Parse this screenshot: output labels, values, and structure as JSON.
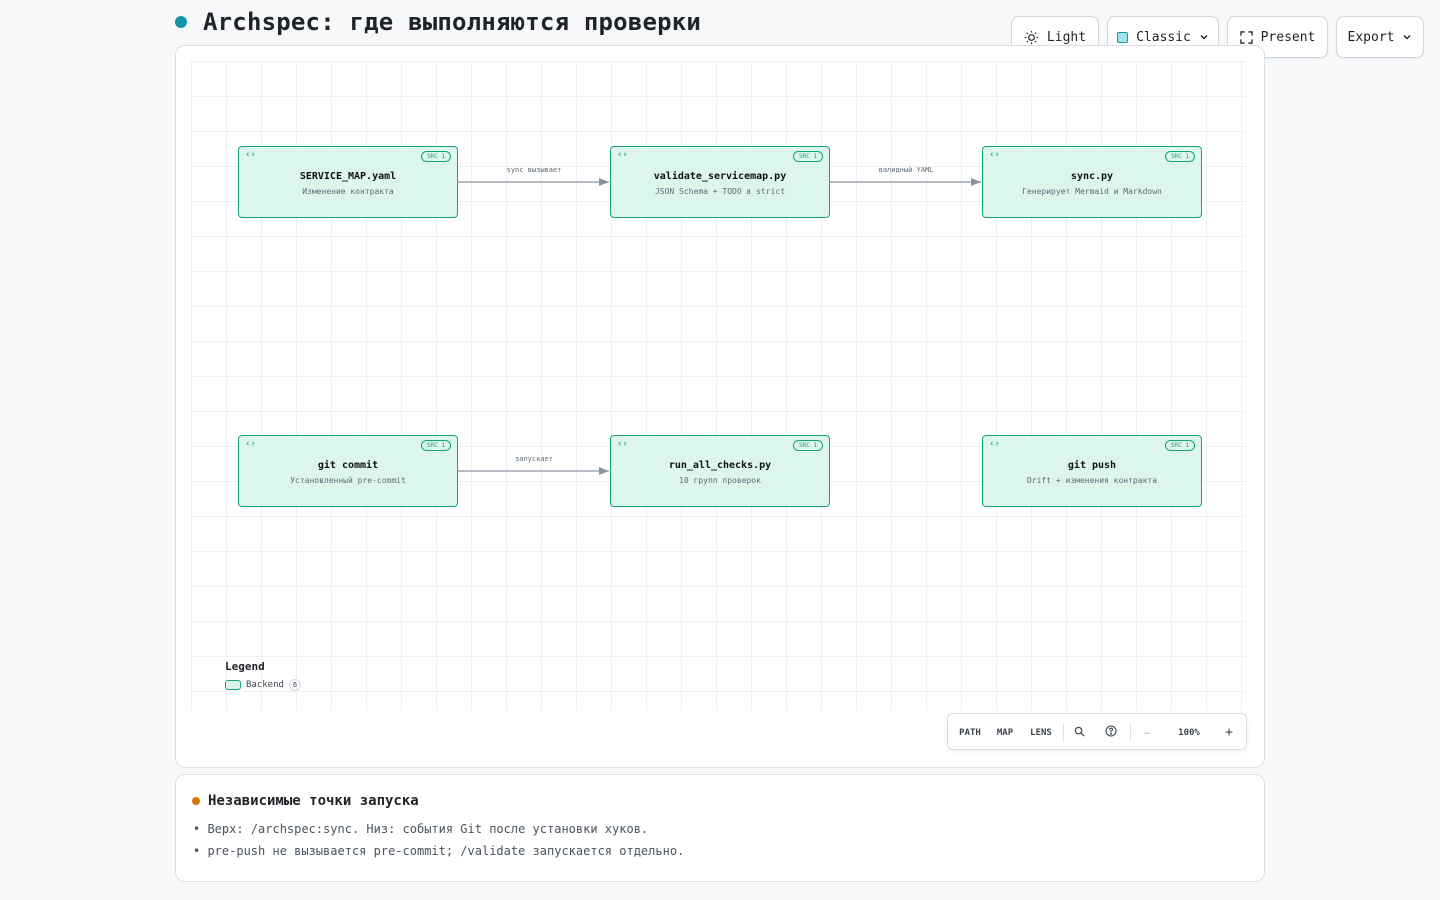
{
  "page": {
    "title": "Archspec: где выполняются проверки",
    "accent": "#1496a8"
  },
  "toolbar": {
    "theme_label": "Light",
    "style_label": "Classic",
    "present_label": "Present",
    "export_label": "Export"
  },
  "diagram": {
    "nodes": [
      {
        "id": "n1",
        "title": "SERVICE_MAP.yaml",
        "subtitle": "Изменение контракта",
        "badge": "SRC 1"
      },
      {
        "id": "n2",
        "title": "validate_servicemap.py",
        "subtitle": "JSON Schema + TODO в strict",
        "badge": "SRC 1"
      },
      {
        "id": "n3",
        "title": "sync.py",
        "subtitle": "Генерирует Mermaid и Markdown",
        "badge": "SRC 1"
      },
      {
        "id": "n4",
        "title": "git commit",
        "subtitle": "Установленный pre-commit",
        "badge": "SRC 1"
      },
      {
        "id": "n5",
        "title": "run_all_checks.py",
        "subtitle": "10 групп проверок",
        "badge": "SRC 1"
      },
      {
        "id": "n6",
        "title": "git push",
        "subtitle": "Drift + изменения контракта",
        "badge": "SRC 1"
      }
    ],
    "edges": [
      {
        "from": "n1",
        "to": "n2",
        "label": "sync вызывает"
      },
      {
        "from": "n2",
        "to": "n3",
        "label": "валидный YAML"
      },
      {
        "from": "n4",
        "to": "n5",
        "label": "запускает"
      }
    ],
    "node_color": "#16a37a",
    "node_fill": "#dcf6ec"
  },
  "legend": {
    "title": "Legend",
    "items": [
      {
        "label": "Backend",
        "count": "6"
      }
    ]
  },
  "controls": {
    "path": "PATH",
    "map": "MAP",
    "lens": "LENS",
    "zoom": "100%",
    "minus": "−",
    "plus": "+"
  },
  "notes": {
    "title": "Независимые точки запуска",
    "lines": [
      "• Верх: /archspec:sync. Низ: события Git после установки хуков.",
      "• pre-push не вызывается pre-commit; /validate запускается отдельно."
    ],
    "accent": "#d97706"
  }
}
